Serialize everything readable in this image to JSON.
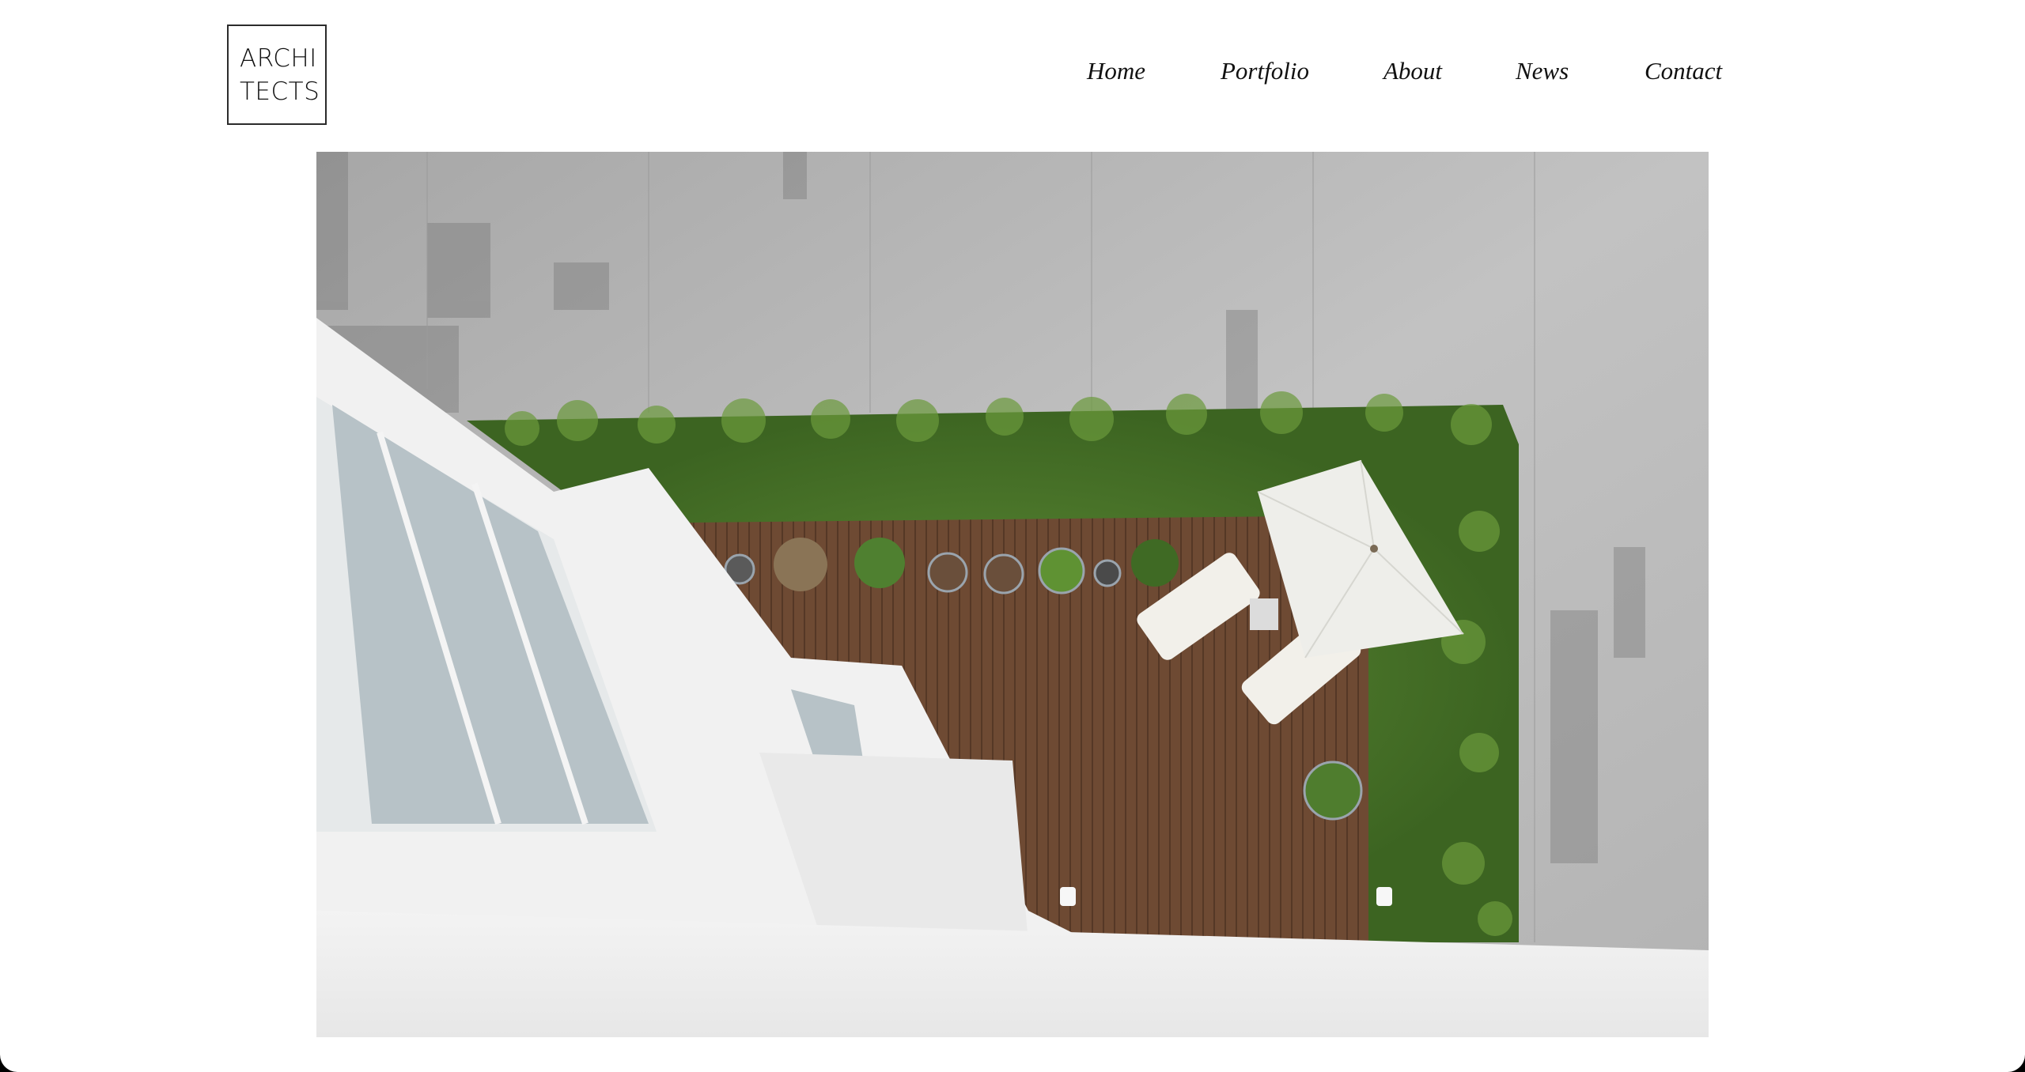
{
  "logo": {
    "line1": "ARCHI",
    "line2": "TECTS"
  },
  "nav": {
    "items": [
      "Home",
      "Portfolio",
      "About",
      "News",
      "Contact"
    ]
  },
  "hero": {
    "image": "aerial-rooftop-terrace-photo",
    "colors": {
      "concrete": "#b8b8b8",
      "deck": "#6e4b35",
      "foliage": "#4f7d2e",
      "building": "#f1f1f1"
    }
  }
}
